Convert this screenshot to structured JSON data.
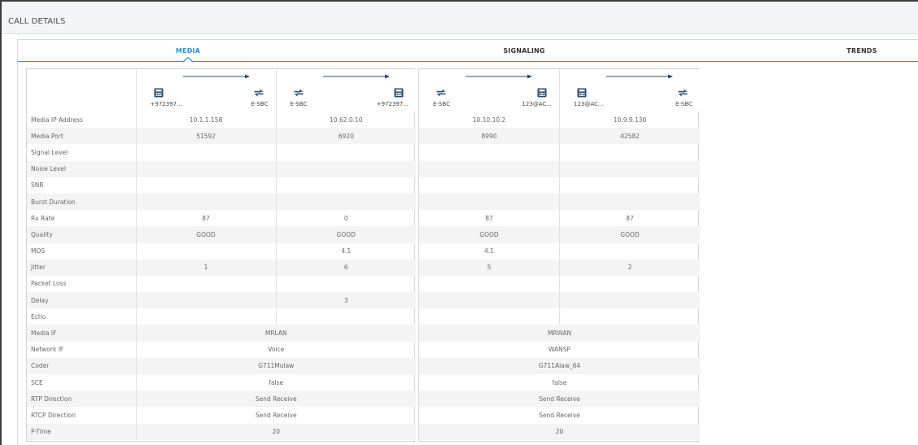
{
  "window": {
    "title": "CALL DETAILS"
  },
  "tabs": [
    {
      "label": "MEDIA",
      "active": true
    },
    {
      "label": "SIGNALING",
      "active": false
    },
    {
      "label": "TRENDS",
      "active": false
    }
  ],
  "colors": {
    "accent": "#2f8fd0",
    "good": "#7cbb2f",
    "icon": "#2b4b6a"
  },
  "row_labels": [
    "Media IP Address",
    "Media Port",
    "Signal Level",
    "Noise Level",
    "SNR",
    "Burst Duration",
    "Rx Rate",
    "Quality",
    "MOS",
    "Jitter",
    "Packet Loss",
    "Delay",
    "Echo",
    "Media IF",
    "Network IF",
    "Coder",
    "SCE",
    "RTP Direction",
    "RTCP Direction",
    "P-Time"
  ],
  "legs": [
    {
      "columns": [
        {
          "from": {
            "icon": "phone-icon",
            "label": "+972397..."
          },
          "to": {
            "icon": "sbc-icon",
            "label": "E-SBC"
          }
        },
        {
          "from": {
            "icon": "sbc-icon",
            "label": "E-SBC"
          },
          "to": {
            "icon": "phone-icon",
            "label": "+972397..."
          }
        }
      ],
      "per_direction": [
        [
          "10.1.1.158",
          "51592",
          "",
          "",
          "",
          "",
          "87",
          "GOOD",
          "",
          "1",
          "",
          "",
          ""
        ],
        [
          "10.62.0.10",
          "6920",
          "",
          "",
          "",
          "",
          "0",
          "GOOD",
          "4.1",
          "6",
          "",
          "3",
          ""
        ]
      ],
      "shared": [
        "MRLAN",
        "Voice",
        "G711Mulaw",
        "false",
        "Send Receive",
        "Send Receive",
        "20"
      ]
    },
    {
      "columns": [
        {
          "from": {
            "icon": "sbc-icon",
            "label": "E-SBC"
          },
          "to": {
            "icon": "phone-icon",
            "label": "123@AC..."
          }
        },
        {
          "from": {
            "icon": "phone-icon",
            "label": "123@AC..."
          },
          "to": {
            "icon": "sbc-icon",
            "label": "E-SBC"
          }
        }
      ],
      "per_direction": [
        [
          "10.10.10.2",
          "8990",
          "",
          "",
          "",
          "",
          "87",
          "GOOD",
          "4.1",
          "5",
          "",
          "",
          ""
        ],
        [
          "10.9.9.130",
          "42582",
          "",
          "",
          "",
          "",
          "87",
          "GOOD",
          "",
          "2",
          "",
          "",
          ""
        ]
      ],
      "shared": [
        "MRWAN",
        "WANSP",
        "G711Alaw_64",
        "false",
        "Send Receive",
        "Send Receive",
        "20"
      ]
    }
  ]
}
